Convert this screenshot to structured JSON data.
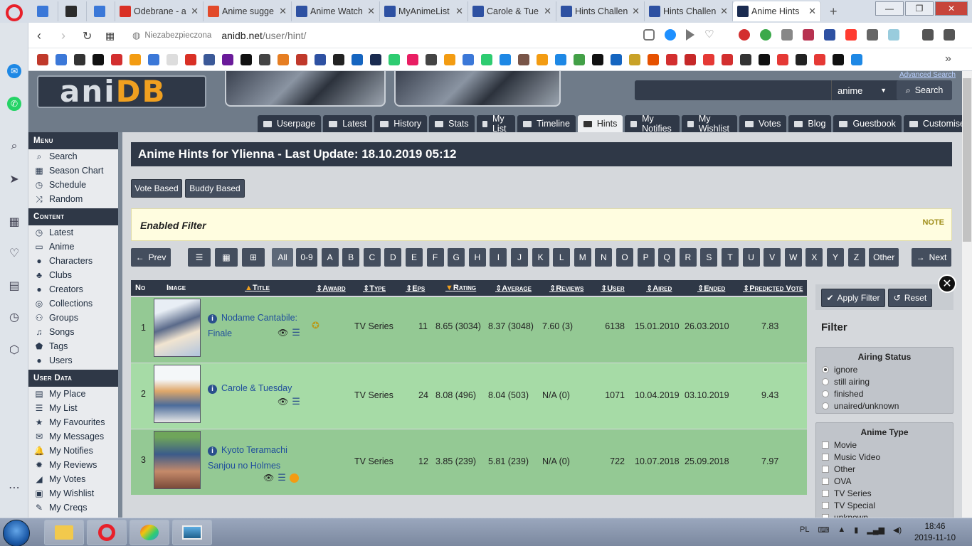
{
  "browser": {
    "tabs": [
      {
        "label": "",
        "color": "#3b78d8"
      },
      {
        "label": "",
        "color": "#2b2b2b"
      },
      {
        "label": "",
        "color": "#3b78d8"
      },
      {
        "label": "Odebrane - a",
        "color": "#d93025"
      },
      {
        "label": "Anime sugge",
        "color": "#e24a2a"
      },
      {
        "label": "Anime Watch",
        "color": "#2e51a2"
      },
      {
        "label": "MyAnimeList",
        "color": "#2e51a2"
      },
      {
        "label": "Carole & Tue",
        "color": "#2e51a2"
      },
      {
        "label": "Hints Challen",
        "color": "#2e51a2"
      },
      {
        "label": "Hints Challen",
        "color": "#2e51a2"
      },
      {
        "label": "Anime Hints",
        "color": "#1a2b50"
      }
    ],
    "new_tab": "+",
    "security": "Niezabezpieczona",
    "url_host": "anidb.net",
    "url_path": "/user/hint/"
  },
  "site": {
    "logo_a": "ani",
    "logo_b": "DB",
    "advanced_search": "Advanced Search",
    "search_type": "anime",
    "search_button": "Search",
    "nav": [
      "Userpage",
      "Latest",
      "History",
      "Stats",
      "My List",
      "Timeline",
      "Hints",
      "My Notifies",
      "My Wishlist",
      "Votes",
      "Blog",
      "Guestbook",
      "Customise"
    ],
    "active_nav": "Hints"
  },
  "menu": {
    "menu_head": "Menu",
    "menu_items": [
      {
        "label": "Search",
        "icon": "search-icon"
      },
      {
        "label": "Season Chart",
        "icon": "grid-icon"
      },
      {
        "label": "Schedule",
        "icon": "clock-icon"
      },
      {
        "label": "Random",
        "icon": "shuffle-icon"
      }
    ],
    "content_head": "Content",
    "content_items": [
      {
        "label": "Latest",
        "icon": "clock-icon"
      },
      {
        "label": "Anime",
        "icon": "tv-icon"
      },
      {
        "label": "Characters",
        "icon": "user-icon"
      },
      {
        "label": "Clubs",
        "icon": "club-icon"
      },
      {
        "label": "Creators",
        "icon": "user-icon"
      },
      {
        "label": "Collections",
        "icon": "collection-icon"
      },
      {
        "label": "Groups",
        "icon": "users-icon"
      },
      {
        "label": "Songs",
        "icon": "music-icon"
      },
      {
        "label": "Tags",
        "icon": "tag-icon"
      },
      {
        "label": "Users",
        "icon": "user-icon"
      }
    ],
    "userdata_head": "User Data",
    "userdata_items": [
      {
        "label": "My Place",
        "icon": "card-icon"
      },
      {
        "label": "My List",
        "icon": "list-icon"
      },
      {
        "label": "My Favourites",
        "icon": "star-icon"
      },
      {
        "label": "My Messages",
        "icon": "envelope-icon"
      },
      {
        "label": "My Notifies",
        "icon": "bell-icon"
      },
      {
        "label": "My Reviews",
        "icon": "gear-icon"
      },
      {
        "label": "My Votes",
        "icon": "chart-icon"
      },
      {
        "label": "My Wishlist",
        "icon": "wishlist-icon"
      },
      {
        "label": "My Creqs",
        "icon": "wrench-icon"
      }
    ]
  },
  "main": {
    "title": "Anime Hints for Ylienna - Last Update: 18.10.2019 05:12",
    "vote_based": "Vote Based",
    "buddy_based": "Buddy Based",
    "filter_title": "Enabled Filter",
    "note": "NOTE",
    "prev": "Prev",
    "next": "Next",
    "alpha": [
      "All",
      "0-9",
      "A",
      "B",
      "C",
      "D",
      "E",
      "F",
      "G",
      "H",
      "I",
      "J",
      "K",
      "L",
      "M",
      "N",
      "O",
      "P",
      "Q",
      "R",
      "S",
      "T",
      "U",
      "V",
      "W",
      "X",
      "Y",
      "Z",
      "Other"
    ],
    "columns": [
      "No",
      "Image",
      "Title",
      "Award",
      "Type",
      "Eps",
      "Rating",
      "Average",
      "Reviews",
      "User",
      "Aired",
      "Ended",
      "Predicted Vote"
    ],
    "rows": [
      {
        "no": "1",
        "title1": "Nodame Cantabile:",
        "title2": "Finale",
        "type": "TV Series",
        "eps": "11",
        "rating": "8.65 (3034)",
        "average": "8.37 (3048)",
        "reviews": "7.60 (3)",
        "users": "6138",
        "aired": "15.01.2010",
        "ended": "26.03.2010",
        "predicted": "7.83",
        "bg": "#94c994"
      },
      {
        "no": "2",
        "title1": "Carole & Tuesday",
        "title2": "",
        "type": "TV Series",
        "eps": "24",
        "rating": "8.08 (496)",
        "average": "8.04 (503)",
        "reviews": "N/A (0)",
        "users": "1071",
        "aired": "10.04.2019",
        "ended": "03.10.2019",
        "predicted": "9.43",
        "bg": "#a6dba6"
      },
      {
        "no": "3",
        "title1": "Kyoto Teramachi",
        "title2": "Sanjou no Holmes",
        "type": "TV Series",
        "eps": "12",
        "rating": "3.85 (239)",
        "average": "5.81 (239)",
        "reviews": "N/A (0)",
        "users": "722",
        "aired": "10.07.2018",
        "ended": "25.09.2018",
        "predicted": "7.97",
        "bg": "#94c994"
      }
    ]
  },
  "filter": {
    "apply": "Apply Filter",
    "reset": "Reset",
    "title": "Filter",
    "airing_title": "Airing Status",
    "airing": [
      "ignore",
      "still airing",
      "finished",
      "unaired/unknown"
    ],
    "type_title": "Anime Type",
    "types": [
      "Movie",
      "Music Video",
      "Other",
      "OVA",
      "TV Series",
      "TV Special",
      "unknown"
    ]
  },
  "taskbar": {
    "lang": "PL",
    "time": "18:46",
    "date": "2019-11-10"
  }
}
